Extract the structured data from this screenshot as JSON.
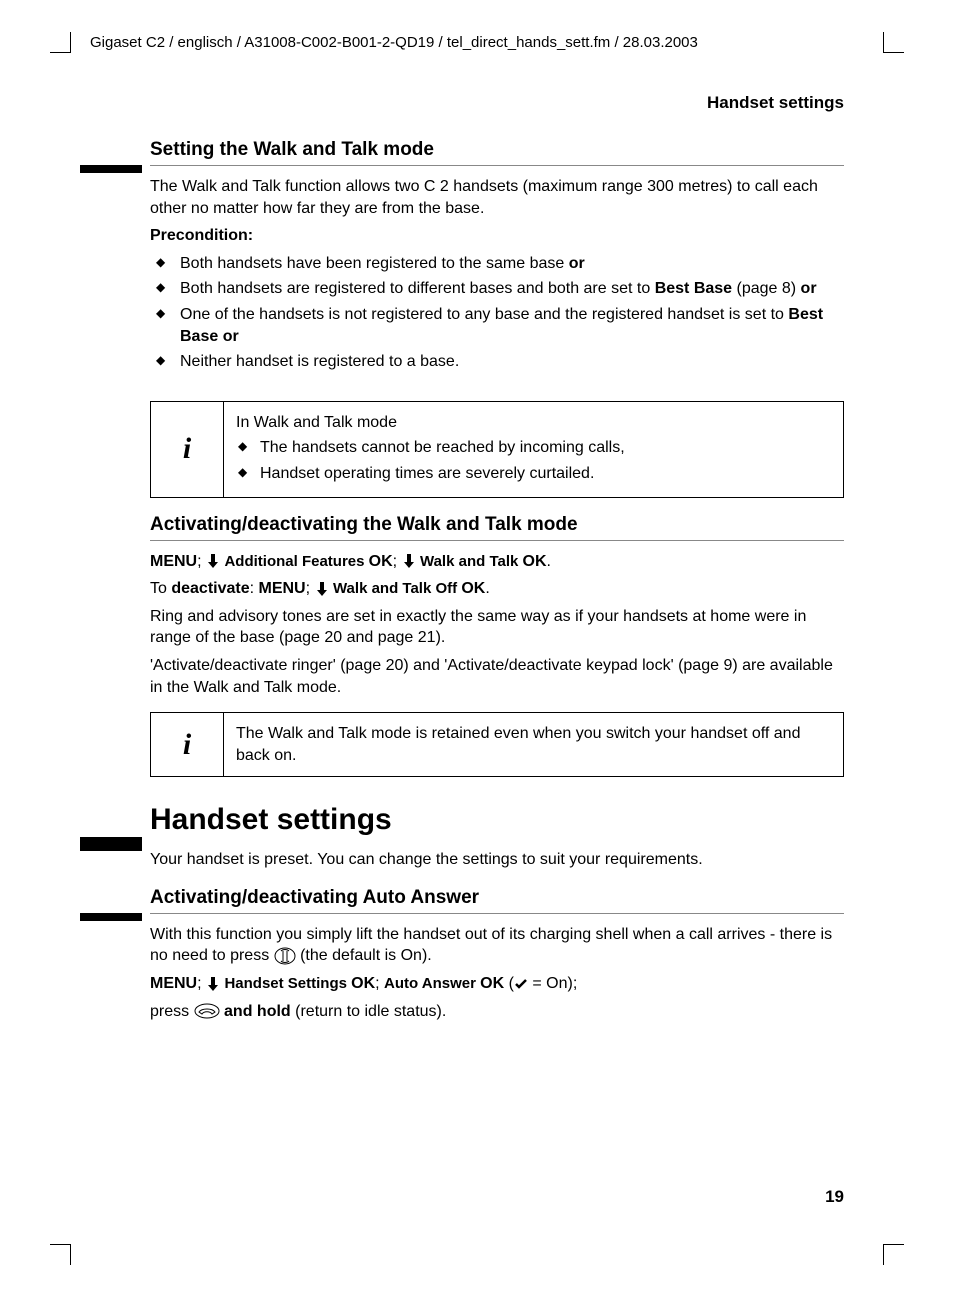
{
  "header_path": "Gigaset C2 / englisch / A31008-C002-B001-2-QD19 / tel_direct_hands_sett.fm / 28.03.2003",
  "section_label": "Handset settings",
  "page_number": "19",
  "section1": {
    "title": "Setting the Walk and Talk mode",
    "intro": "The Walk and Talk function allows two C 2 handsets (maximum range 300 metres) to call each other no matter how far they are from the base.",
    "precond_label": "Precondition:",
    "bullets": {
      "b1": "Both handsets have been registered to the same base ",
      "b1_or": "or",
      "b2a": "Both handsets are registered to different bases and both are set to ",
      "b2b": "Best Base",
      "b2c": " (page 8) ",
      "b2_or": "or",
      "b3a": "One of the handsets is not registered to any base and the registered handset is set to ",
      "b3b": "Best Base or",
      "b4": "Neither handset is registered to a base."
    },
    "info1": {
      "lead": "In Walk and Talk mode",
      "b1": "The handsets cannot be reached by incoming calls,",
      "b2": "Handset operating times are severely curtailed."
    }
  },
  "section2": {
    "title": "Activating/deactivating the Walk and Talk mode",
    "nav": {
      "menu": "MENU",
      "semi": "; ",
      "item1": " Additional Features ",
      "ok": "OK",
      "item2": " Walk and Talk ",
      "period": ".",
      "deact_pre": "To ",
      "deact": "deactivate",
      "colon": ": ",
      "item3": " Walk and Talk Off "
    },
    "p1": "Ring and advisory tones are set in exactly the same way as if your handsets at home were in range of the base (page 20 and page 21).",
    "p2": "'Activate/deactivate ringer' (page 20) and 'Activate/deactivate keypad lock' (page 9) are available in the Walk and Talk mode.",
    "info2": "The Walk and Talk mode is retained even when you switch your handset off and back on."
  },
  "section3": {
    "title": "Handset settings",
    "intro": "Your handset is preset. You can change the settings to suit your requirements."
  },
  "section4": {
    "title": "Activating/deactivating Auto Answer",
    "p1a": "With this function you simply lift the handset out of its charging shell when a call arrives - there is no need to press ",
    "p1b": " (the default is On).",
    "nav": {
      "item1": " Handset Settings ",
      "item2": "Auto Answer ",
      "on": " = On);"
    },
    "p2a": "press ",
    "p2b": " and hold",
    "p2c": " (return to idle status)."
  }
}
